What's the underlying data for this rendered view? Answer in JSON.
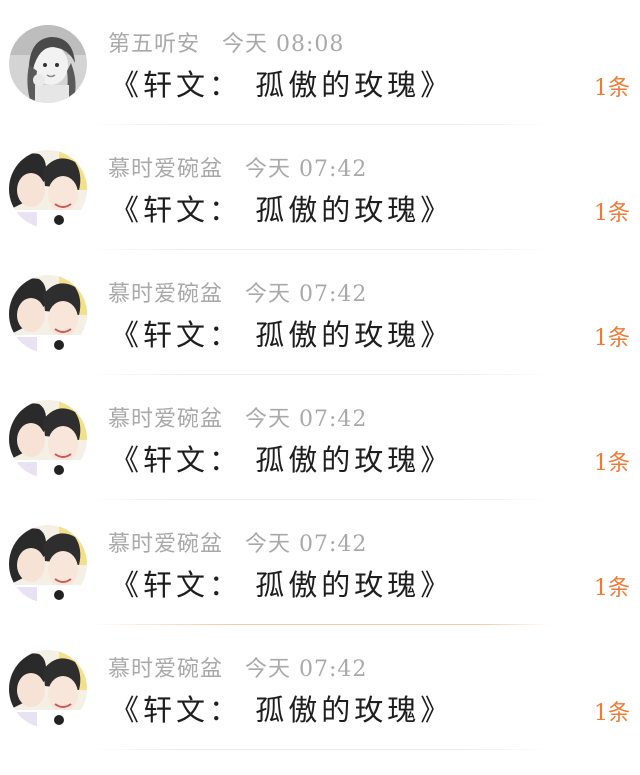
{
  "messages": [
    {
      "sender": "第五听安",
      "time": "今天 08:08",
      "title": "《轩文： 孤傲的玫瑰》",
      "count": "1条",
      "avatar": "avatar-portrait-bw-icon"
    },
    {
      "sender": "慕时爱碗盆",
      "time": "今天 07:42",
      "title": "《轩文： 孤傲的玫瑰》",
      "count": "1条",
      "avatar": "avatar-two-people-icon"
    },
    {
      "sender": "慕时爱碗盆",
      "time": "今天 07:42",
      "title": "《轩文： 孤傲的玫瑰》",
      "count": "1条",
      "avatar": "avatar-two-people-icon"
    },
    {
      "sender": "慕时爱碗盆",
      "time": "今天 07:42",
      "title": "《轩文： 孤傲的玫瑰》",
      "count": "1条",
      "avatar": "avatar-two-people-icon"
    },
    {
      "sender": "慕时爱碗盆",
      "time": "今天 07:42",
      "title": "《轩文： 孤傲的玫瑰》",
      "count": "1条",
      "avatar": "avatar-two-people-icon"
    },
    {
      "sender": "慕时爱碗盆",
      "time": "今天 07:42",
      "title": "《轩文： 孤傲的玫瑰》",
      "count": "1条",
      "avatar": "avatar-two-people-icon"
    }
  ],
  "colors": {
    "meta_text": "#a9a9a9",
    "title_text": "#1e1e1e",
    "count_text": "#f07a34"
  }
}
